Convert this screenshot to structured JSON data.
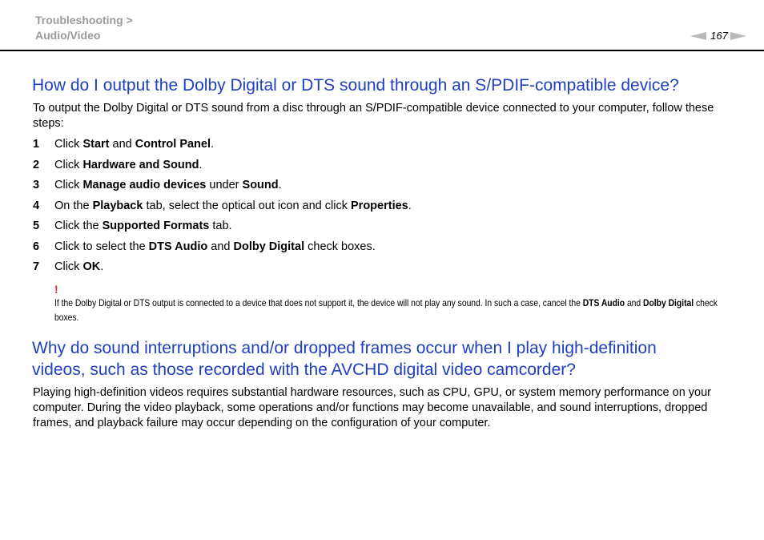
{
  "header": {
    "breadcrumb_line1": "Troubleshooting >",
    "breadcrumb_line2": "Audio/Video",
    "page_number": "167"
  },
  "section1": {
    "title": "How do I output the Dolby Digital or DTS sound through an S/PDIF-compatible device?",
    "intro": "To output the Dolby Digital or DTS sound from a disc through an S/PDIF-compatible device connected to your computer, follow these steps:",
    "steps": [
      {
        "num": "1",
        "parts": [
          "Click ",
          "Start",
          " and ",
          "Control Panel",
          "."
        ]
      },
      {
        "num": "2",
        "parts": [
          "Click ",
          "Hardware and Sound",
          "."
        ]
      },
      {
        "num": "3",
        "parts": [
          "Click ",
          "Manage audio devices",
          " under ",
          "Sound",
          "."
        ]
      },
      {
        "num": "4",
        "parts": [
          "On the ",
          "Playback",
          " tab, select the optical out icon and click ",
          "Properties",
          "."
        ]
      },
      {
        "num": "5",
        "parts": [
          "Click the ",
          "Supported Formats",
          " tab."
        ]
      },
      {
        "num": "6",
        "parts": [
          "Click to select the ",
          "DTS Audio",
          " and ",
          "Dolby Digital",
          " check boxes."
        ]
      },
      {
        "num": "7",
        "parts": [
          "Click ",
          "OK",
          "."
        ]
      }
    ],
    "note": {
      "mark": "!",
      "parts": [
        "If the Dolby Digital or DTS output is connected to a device that does not support it, the device will not play any sound. In such a case, cancel the ",
        "DTS Audio",
        " and ",
        "Dolby Digital",
        " check boxes."
      ]
    }
  },
  "section2": {
    "title_line1": "Why do sound interruptions and/or dropped frames occur when I play high-definition",
    "title_line2": "videos, such as those recorded with the AVCHD digital video camcorder?",
    "body": "Playing high-definition videos requires substantial hardware resources, such as CPU, GPU, or system memory performance on your computer. During the video playback, some operations and/or functions may become unavailable, and sound interruptions, dropped frames, and playback failure may occur depending on the configuration of your computer."
  },
  "colors": {
    "heading": "#1f3fbf",
    "breadcrumb": "#9a9a9a",
    "note_mark": "#e0202a"
  }
}
